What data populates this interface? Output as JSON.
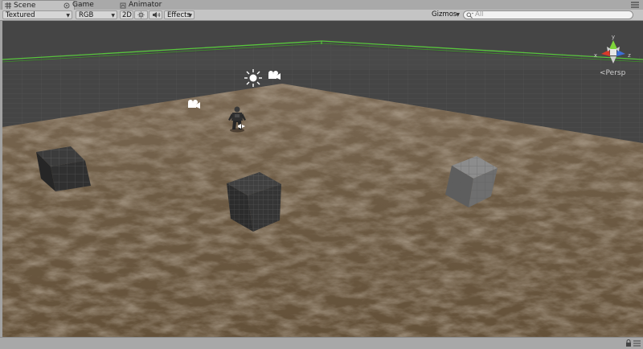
{
  "tabs": [
    {
      "label": "Scene",
      "icon": "scene-icon",
      "active": true
    },
    {
      "label": "Game",
      "icon": "game-icon",
      "active": false
    },
    {
      "label": "Animator",
      "icon": "animator-icon",
      "active": false
    }
  ],
  "toolbar": {
    "render_mode": "Textured",
    "color_mode": "RGB",
    "mode_2d": "2D",
    "effects": "Effects",
    "gizmos": "Gizmos",
    "search_placeholder": "All"
  },
  "viewport": {
    "projection_label": "Persp",
    "gizmo_axes": {
      "y": "y",
      "x": "x",
      "z": "z"
    },
    "colors": {
      "sky": "#454545",
      "ground": "#6e5a43",
      "bounds": "#58c43d",
      "axis_x": "#d83a2b",
      "axis_y": "#7fd53a",
      "axis_z": "#3c6fd8"
    }
  }
}
